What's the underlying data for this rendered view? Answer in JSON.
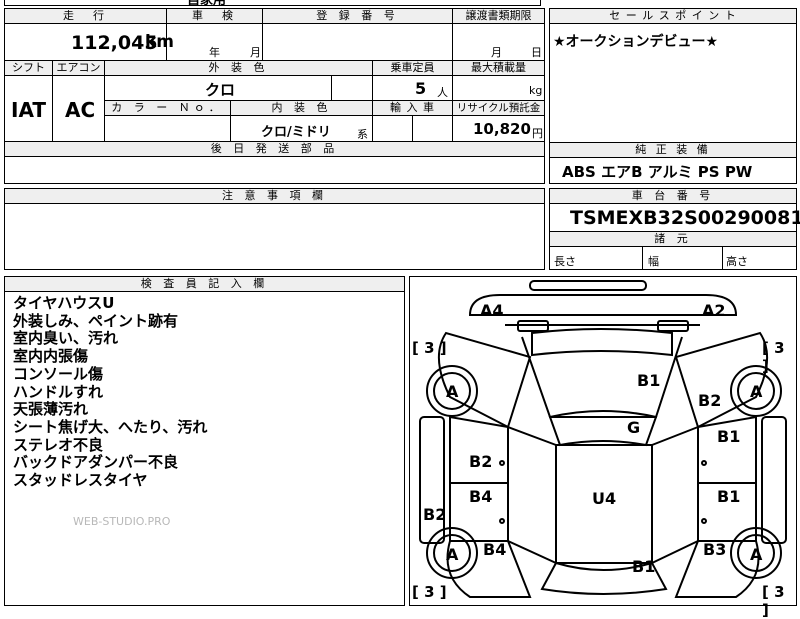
{
  "top_strip": {
    "partial": "自家用"
  },
  "mileage": {
    "label": "走　行",
    "value": "112,045",
    "unit": "km"
  },
  "shaken": {
    "label": "車　検",
    "year_unit": "年",
    "month_unit": "月"
  },
  "registration": {
    "label": "登 録 番 号",
    "value": ""
  },
  "transfer_deadline": {
    "label": "譲渡書類期限",
    "month_unit": "月",
    "day_unit": "日"
  },
  "sales_point": {
    "label": "セ ー ル ス ポ イ ン ト",
    "text": "★オークションデビュー★"
  },
  "shift": {
    "label": "シフト",
    "value": "IAT"
  },
  "aircon": {
    "label": "エアコン",
    "value": "AC"
  },
  "exterior_color": {
    "label": "外 装 色",
    "value": "クロ"
  },
  "capacity": {
    "label": "乗車定員",
    "value": "5",
    "unit": "人"
  },
  "max_load": {
    "label": "最大積載量",
    "unit": "kg"
  },
  "color_no": {
    "label": "カ ラ ー Ｎｏ．"
  },
  "interior_color": {
    "label": "内 装 色",
    "value": "クロ/ミドリ",
    "suffix": "系"
  },
  "import": {
    "label": "輸 入 車"
  },
  "recycle": {
    "label": "リサイクル預託金",
    "value": "10,820",
    "unit": "円"
  },
  "later_parts": {
    "label": "後 日 発 送 部 品"
  },
  "equipment": {
    "label": "純 正 装 備",
    "items": "ABS エアB アルミ PS PW"
  },
  "notes": {
    "label": "注 意 事 項 欄"
  },
  "chassis": {
    "label": "車 台 番 号",
    "value": "TSMEXB32S00290081"
  },
  "dimensions": {
    "label": "諸 元",
    "length": "長さ",
    "width": "幅",
    "height": "高さ"
  },
  "inspector": {
    "label": "検 査 員 記 入 欄",
    "lines": [
      "タイヤハウスU",
      "外装しみ、ペイント跡有",
      "室内臭い、汚れ",
      "室内内張傷",
      "コンソール傷",
      "ハンドルすれ",
      "天張薄汚れ",
      "シート焦げ大、へたり、汚れ",
      "ステレオ不良",
      "バックドアダンパー不良",
      "スタッドレスタイヤ"
    ],
    "watermark": "WEB-STUDIO.PRO"
  },
  "diagram": {
    "marks": {
      "a4": "A4",
      "a2": "A2",
      "b1_hood": "B1",
      "b2_front_right": "B2",
      "g": "G",
      "b1_rf_door": "B1",
      "b2_lf_door": "B2",
      "b4_lr_door": "B4",
      "u4": "U4",
      "b1_rr_door": "B1",
      "b2_left_rocker": "B2",
      "b4_left_rear": "B4",
      "b3_right_rear": "B3",
      "b1_rear": "B1",
      "tire_lf": "A",
      "tire_rf": "A",
      "tire_lr": "A",
      "tire_rr": "A",
      "tread_lf": "[ 3 ]",
      "tread_rf": "[ 3 ]",
      "tread_lr": "[ 3 ]",
      "tread_rr": "[ 3 ]"
    }
  }
}
